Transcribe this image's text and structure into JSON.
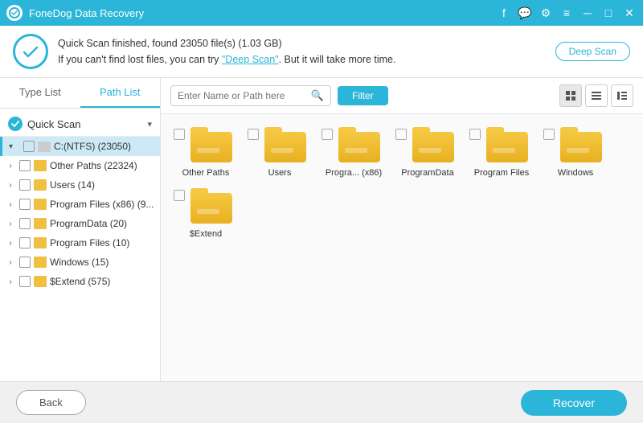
{
  "titleBar": {
    "appName": "FoneDog Data Recovery",
    "icons": [
      "facebook",
      "chat",
      "settings",
      "menu",
      "minimize",
      "maximize",
      "close"
    ]
  },
  "notification": {
    "statusText": "Quick Scan finished, found 23050 file(s) (1.03 GB)",
    "hintText": "If you can't find lost files, you can try ",
    "linkText": "\"Deep Scan\"",
    "hintText2": ". But it will take more time.",
    "deepScanLabel": "Deep Scan"
  },
  "sidebar": {
    "tab1": "Type List",
    "tab2": "Path List",
    "quickScan": "Quick Scan",
    "driveLabel": "C:(NTFS) (23050)",
    "items": [
      {
        "label": "Other Paths (22324)"
      },
      {
        "label": "Users (14)"
      },
      {
        "label": "Program Files (x86) (9..."
      },
      {
        "label": "ProgramData (20)"
      },
      {
        "label": "Program Files (10)"
      },
      {
        "label": "Windows (15)"
      },
      {
        "label": "$Extend (575)"
      }
    ]
  },
  "toolbar": {
    "searchPlaceholder": "Enter Name or Path here",
    "filterLabel": "Filter",
    "views": [
      "grid",
      "list",
      "detail"
    ]
  },
  "fileGrid": {
    "items": [
      {
        "label": "Other Paths"
      },
      {
        "label": "Users"
      },
      {
        "label": "Progra... (x86)"
      },
      {
        "label": "ProgramData"
      },
      {
        "label": "Program Files"
      },
      {
        "label": "Windows"
      },
      {
        "label": "$Extend"
      }
    ]
  },
  "bottomBar": {
    "backLabel": "Back",
    "recoverLabel": "Recover"
  }
}
